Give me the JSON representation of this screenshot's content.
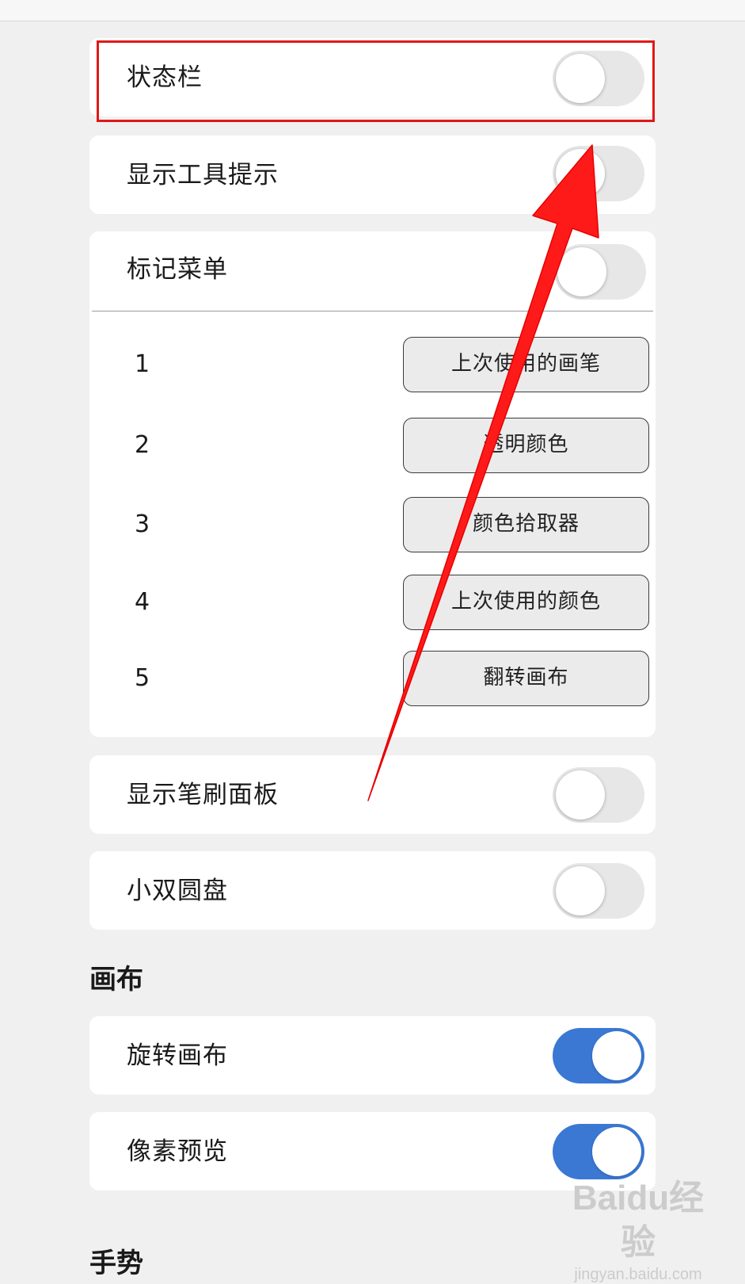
{
  "settings": {
    "status_bar": {
      "label": "状态栏",
      "enabled": false
    },
    "show_tooltips": {
      "label": "显示工具提示",
      "enabled": false
    },
    "marking_menu": {
      "label": "标记菜单",
      "enabled": false,
      "items": [
        {
          "index": "1",
          "action": "上次使用的画笔"
        },
        {
          "index": "2",
          "action": "透明颜色"
        },
        {
          "index": "3",
          "action": "颜色拾取器"
        },
        {
          "index": "4",
          "action": "上次使用的颜色"
        },
        {
          "index": "5",
          "action": "翻转画布"
        }
      ]
    },
    "show_brush_panel": {
      "label": "显示笔刷面板",
      "enabled": false
    },
    "mini_dual_puck": {
      "label": "小双圆盘",
      "enabled": false
    }
  },
  "canvas_section": {
    "title": "画布",
    "rotate_canvas": {
      "label": "旋转画布",
      "enabled": true
    },
    "pixel_preview": {
      "label": "像素预览",
      "enabled": true
    }
  },
  "gestures_section": {
    "title": "手势"
  },
  "watermark": {
    "logo": "Baidu经验",
    "url": "jingyan.baidu.com"
  },
  "colors": {
    "toggle_on": "#3a78d4",
    "toggle_off": "#e7e7e7",
    "highlight": "#e01818",
    "arrow": "#ff1a1a"
  }
}
